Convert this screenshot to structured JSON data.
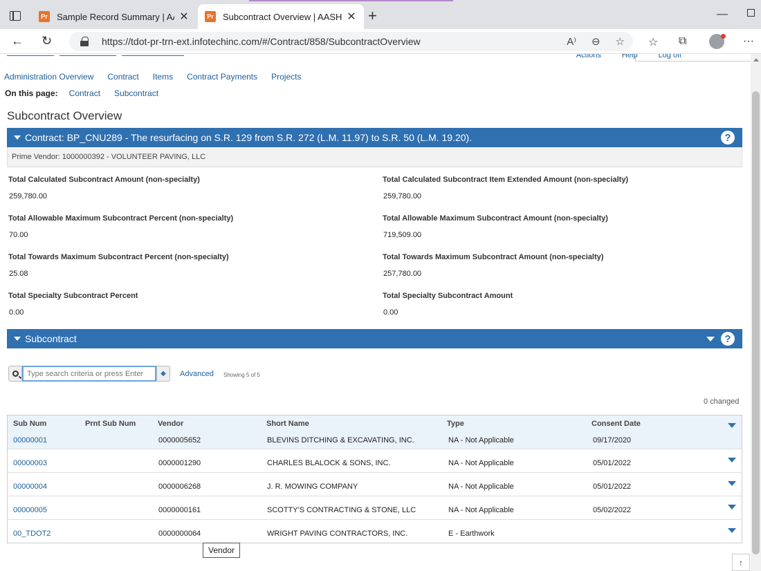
{
  "browser": {
    "tabs": [
      {
        "label": "Sample Record Summary | AASH",
        "favicon": "Pr",
        "active": false
      },
      {
        "label": "Subcontract Overview | AASHTO\\",
        "favicon": "Pr",
        "active": true
      }
    ],
    "url": "https://tdot-pr-trn-ext.infotechinc.com/#/Contract/858/SubcontractOverview"
  },
  "top_strip": {
    "links": [
      "Actions",
      "Help",
      "Log off"
    ]
  },
  "nav": {
    "links": [
      "Administration Overview",
      "Contract",
      "Items",
      "Contract Payments",
      "Projects"
    ],
    "on_this_page_label": "On this page:",
    "on_this_page": [
      "Contract",
      "Subcontract"
    ]
  },
  "page_title": "Subcontract Overview",
  "contract_panel": {
    "title": "Contract: BP_CNU289 - The resurfacing on S.R. 129 from S.R. 272 (L.M. 11.97) to S.R. 50 (L.M. 19.20).",
    "prime_vendor": "Prime Vendor: 1000000392 - VOLUNTEER PAVING, LLC"
  },
  "fields": [
    {
      "label": "Total Calculated Subcontract Amount (non-specialty)",
      "value": "259,780.00"
    },
    {
      "label": "Total Calculated Subcontract Item Extended Amount (non-specialty)",
      "value": "259,780.00"
    },
    {
      "label": "Total Allowable Maximum Subcontract Percent (non-specialty)",
      "value": "70.00"
    },
    {
      "label": "Total Allowable Maximum Subcontract Amount (non-specialty)",
      "value": "719,509.00"
    },
    {
      "label": "Total Towards Maximum Subcontract Percent (non-specialty)",
      "value": "25.08"
    },
    {
      "label": "Total Towards Maximum Subcontract Amount (non-specialty)",
      "value": "257,780.00"
    },
    {
      "label": "Total Specialty Subcontract Percent",
      "value": "0.00"
    },
    {
      "label": "Total Specialty Subcontract Amount",
      "value": "0.00"
    }
  ],
  "subcontract_panel": {
    "title": "Subcontract"
  },
  "search": {
    "placeholder": "Type search criteria or press Enter",
    "advanced_label": "Advanced",
    "showing": "Showing 5 of 5"
  },
  "changed": "0 changed",
  "grid": {
    "columns": [
      "Sub Num",
      "Prnt Sub Num",
      "Vendor",
      "Short Name",
      "Type",
      "Consent Date"
    ],
    "rows": [
      {
        "sub_num": "00000001",
        "prnt_sub_num": "",
        "vendor": "0000005652",
        "short_name": "BLEVINS DITCHING & EXCAVATING, INC.",
        "type": "NA - Not Applicable",
        "consent_date": "09/17/2020"
      },
      {
        "sub_num": "00000003",
        "prnt_sub_num": "",
        "vendor": "0000001290",
        "short_name": "CHARLES BLALOCK & SONS, INC.",
        "type": "NA - Not Applicable",
        "consent_date": "05/01/2022"
      },
      {
        "sub_num": "00000004",
        "prnt_sub_num": "",
        "vendor": "0000006268",
        "short_name": "J. R. MOWING COMPANY",
        "type": "NA - Not Applicable",
        "consent_date": "05/01/2022"
      },
      {
        "sub_num": "00000005",
        "prnt_sub_num": "",
        "vendor": "0000000161",
        "short_name": "SCOTTY'S CONTRACTING & STONE, LLC",
        "type": "NA - Not Applicable",
        "consent_date": "05/02/2022"
      },
      {
        "sub_num": "00_TDOT2",
        "prnt_sub_num": "",
        "vendor": "0000000064",
        "short_name": "WRIGHT PAVING CONTRACTORS, INC.",
        "type": "E - Earthwork",
        "consent_date": ""
      }
    ]
  },
  "tooltip": "Vendor",
  "icons": {
    "back": "back-arrow-icon",
    "refresh": "refresh-icon",
    "lock": "lock-icon",
    "read_aloud": "read-aloud-icon",
    "zoom": "zoom-out-icon",
    "favorite": "add-favorite-icon",
    "favorites": "favorites-icon",
    "collections": "collections-icon",
    "more": "more-icon",
    "help": "help-icon",
    "search": "search-icon",
    "clear": "eraser-icon"
  },
  "colors": {
    "panel_header": "#2f70b0",
    "link": "#1b5e97",
    "grid_header": "#eaf2fa"
  }
}
